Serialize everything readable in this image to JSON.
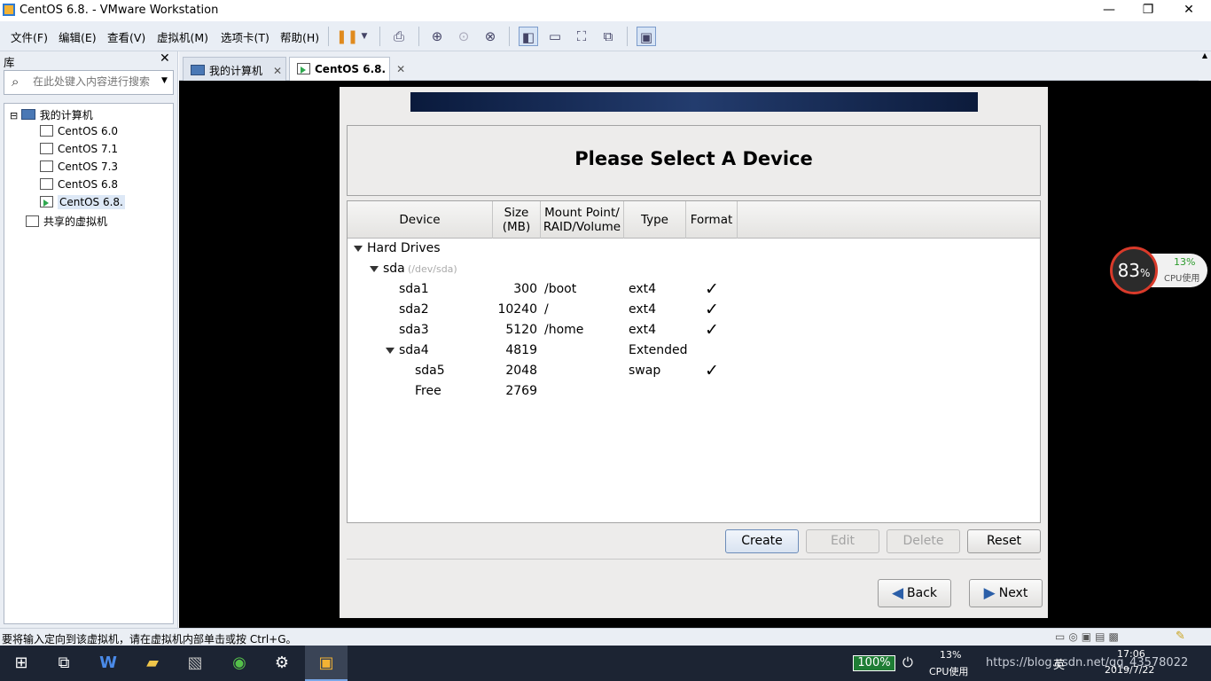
{
  "window": {
    "title": "CentOS 6.8. - VMware Workstation"
  },
  "menu": [
    "文件(F)",
    "编辑(E)",
    "查看(V)",
    "虚拟机(M)",
    "选项卡(T)",
    "帮助(H)"
  ],
  "library": {
    "title": "库",
    "search_placeholder": "在此处键入内容进行搜索",
    "tree": [
      {
        "label": "我的计算机",
        "level": 0,
        "icon": "computer-icon"
      },
      {
        "label": "CentOS 6.0",
        "level": 1,
        "icon": "vm-icon"
      },
      {
        "label": "CentOS 7.1",
        "level": 1,
        "icon": "vm-icon"
      },
      {
        "label": "CentOS 7.3",
        "level": 1,
        "icon": "vm-icon"
      },
      {
        "label": "CentOS 6.8",
        "level": 1,
        "icon": "vm-icon"
      },
      {
        "label": "CentOS 6.8.",
        "level": 1,
        "icon": "vm-running-icon",
        "selected": true
      },
      {
        "label": "共享的虚拟机",
        "level": 0,
        "icon": "shared-vm-icon"
      }
    ]
  },
  "tabs": [
    {
      "label": "我的计算机",
      "active": false
    },
    {
      "label": "CentOS 6.8.",
      "active": true
    }
  ],
  "installer": {
    "heading": "Please Select A Device",
    "columns": [
      "Device",
      "Size\n(MB)",
      "Mount Point/\nRAID/Volume",
      "Type",
      "Format"
    ],
    "rows": [
      {
        "device": "Hard Drives",
        "indent": 0,
        "expander": true
      },
      {
        "device": "sda",
        "sub": "(/dev/sda)",
        "indent": 1,
        "expander": true
      },
      {
        "device": "sda1",
        "size": "300",
        "mount": "/boot",
        "type": "ext4",
        "format": true,
        "indent": 2
      },
      {
        "device": "sda2",
        "size": "10240",
        "mount": "/",
        "type": "ext4",
        "format": true,
        "indent": 2
      },
      {
        "device": "sda3",
        "size": "5120",
        "mount": "/home",
        "type": "ext4",
        "format": true,
        "indent": 2
      },
      {
        "device": "sda4",
        "size": "4819",
        "mount": "",
        "type": "Extended",
        "format": false,
        "indent": 2,
        "expander": true
      },
      {
        "device": "sda5",
        "size": "2048",
        "mount": "",
        "type": "swap",
        "format": true,
        "indent": 3
      },
      {
        "device": "Free",
        "size": "2769",
        "mount": "",
        "type": "",
        "format": false,
        "indent": 3
      }
    ],
    "buttons": {
      "create": "Create",
      "edit": "Edit",
      "delete": "Delete",
      "reset": "Reset",
      "back": "Back",
      "next": "Next"
    },
    "format_mark": "✓"
  },
  "cpu_widget": {
    "percent": "83",
    "unit": "%",
    "usage": "13%",
    "label": "CPU使用"
  },
  "status": {
    "message": "要将输入定向到该虚拟机，请在虚拟机内部单击或按 Ctrl+G。"
  },
  "taskbar": {
    "battery": "100%",
    "cpu_usage": "13%",
    "cpu_label": "CPU使用",
    "watermark": "https://blog.csdn.net/qq_43578022",
    "ime": "英",
    "time": "17:06",
    "date": "2019/7/22"
  },
  "colors": {
    "accent": "#2d7bd4",
    "banner": "#0a1a3c",
    "cpu_ring": "#d93a2a",
    "usage_green": "#2a9a2a"
  }
}
